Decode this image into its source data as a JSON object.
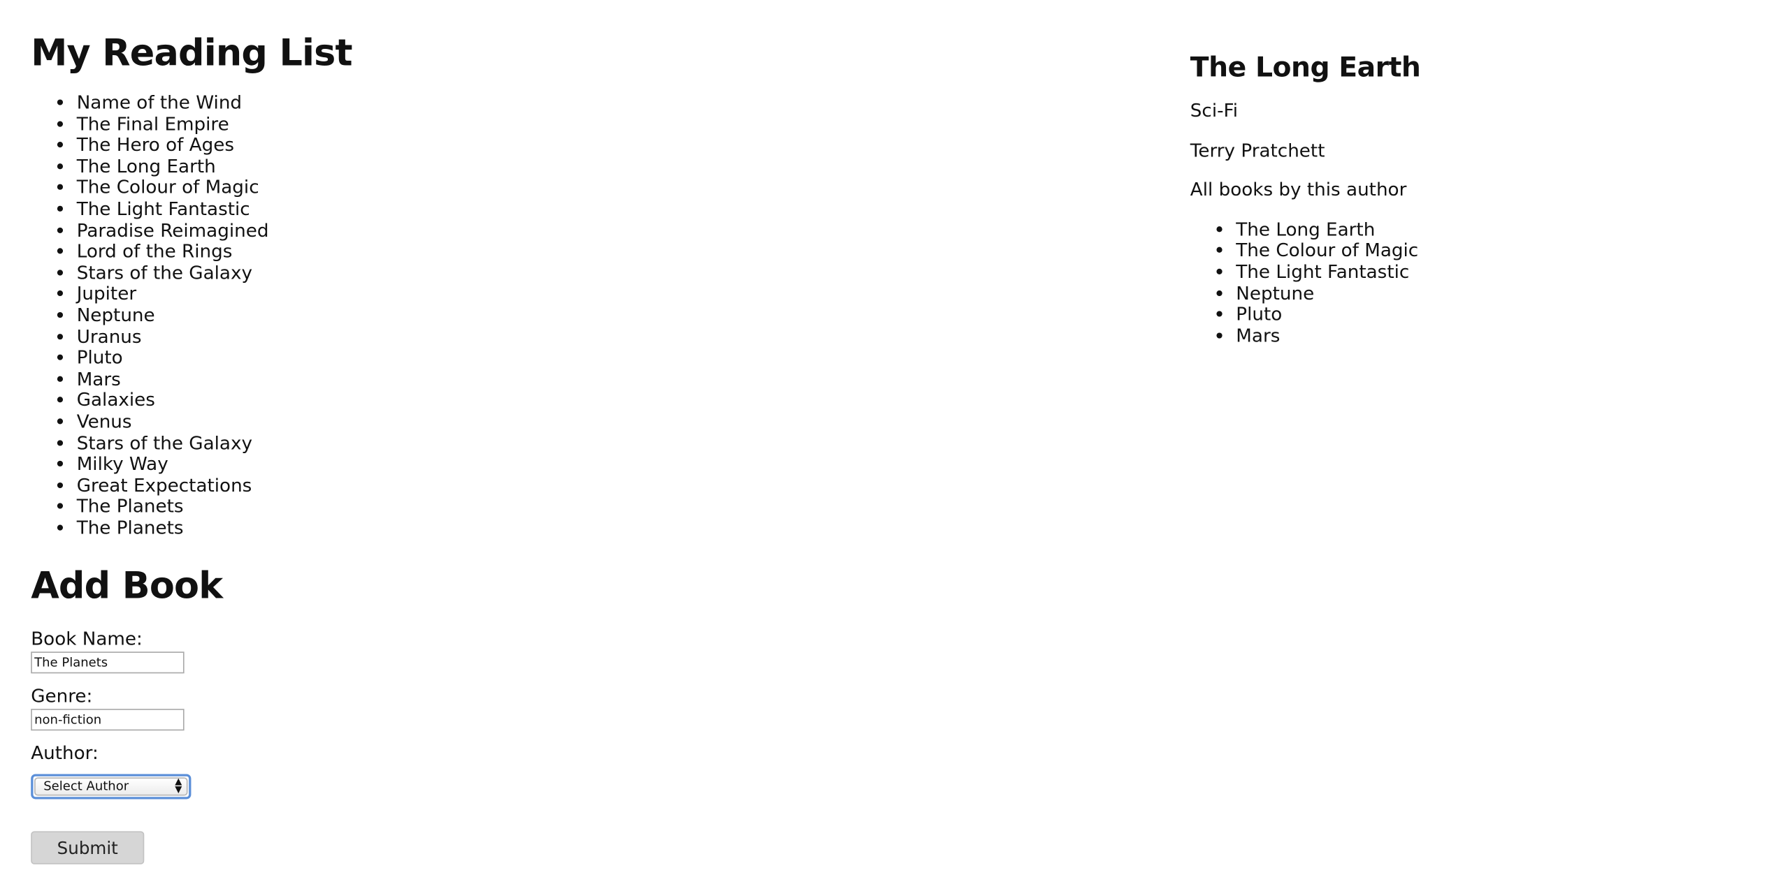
{
  "main": {
    "title": "My Reading List",
    "books": [
      "Name of the Wind",
      "The Final Empire",
      "The Hero of Ages",
      "The Long Earth",
      "The Colour of Magic",
      "The Light Fantastic",
      "Paradise Reimagined",
      "Lord of the Rings",
      "Stars of the Galaxy",
      "Jupiter",
      "Neptune",
      "Uranus",
      "Pluto",
      "Mars",
      "Galaxies",
      "Venus",
      "Stars of the Galaxy",
      "Milky Way",
      "Great Expectations",
      "The Planets",
      "The Planets"
    ]
  },
  "add_book": {
    "title": "Add Book",
    "book_name_label": "Book Name:",
    "book_name_value": "The Planets",
    "genre_label": "Genre:",
    "genre_value": "non-fiction",
    "author_label": "Author:",
    "author_selected": "Select Author",
    "submit_label": "Submit"
  },
  "details": {
    "title": "The Long Earth",
    "genre": "Sci-Fi",
    "author": "Terry Pratchett",
    "all_books_label": "All books by this author",
    "author_books": [
      "The Long Earth",
      "The Colour of Magic",
      "The Light Fantastic",
      "Neptune",
      "Pluto",
      "Mars"
    ]
  },
  "colors": {
    "focus_ring": "#5b8fd8",
    "button_bg": "#d6d6d6"
  }
}
